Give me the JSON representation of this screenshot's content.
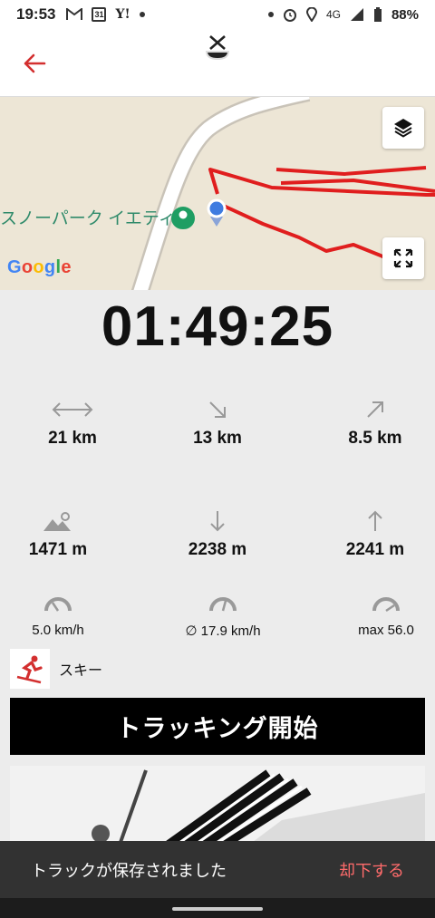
{
  "status_bar": {
    "time": "19:53",
    "left_icons": [
      "gmail-icon",
      "calendar-icon",
      "yahoo-icon",
      "dot"
    ],
    "calendar_day": "31",
    "yahoo_text": "Y!",
    "network": "4G",
    "battery": "88%"
  },
  "map": {
    "place_label": "スノーパーク イエティ",
    "attribution": "Google",
    "route_color": "#e01e1e"
  },
  "timer": "01:49:25",
  "stats": {
    "distance": "21 km",
    "descent_distance": "13 km",
    "ascent_distance": "8.5 km",
    "altitude": "1471 m",
    "descent": "2238 m",
    "ascent": "2241 m",
    "min_speed": "5.0 km/h",
    "avg_speed": "∅ 17.9 km/h",
    "max_speed": "max 56.0"
  },
  "activity": {
    "label": "スキー"
  },
  "start_button": "トラッキング開始",
  "snackbar": {
    "message": "トラックが保存されました",
    "action": "却下する"
  },
  "colors": {
    "accent": "#d32f2f",
    "snackbar_action": "#ff6b6b"
  }
}
